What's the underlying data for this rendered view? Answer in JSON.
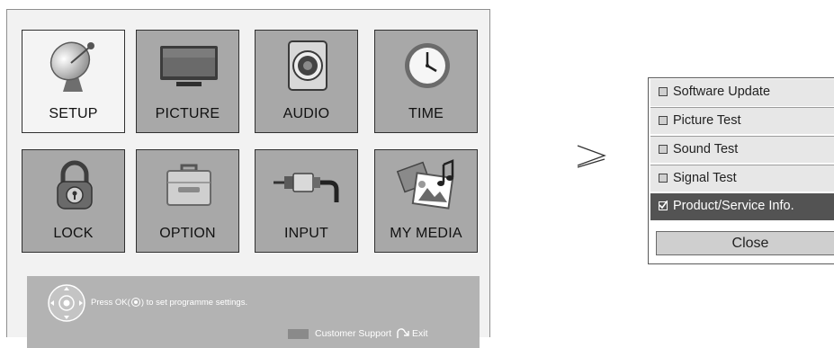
{
  "menu": {
    "tiles": [
      {
        "label": "SETUP",
        "icon": "satellite-dish-icon",
        "selected": true
      },
      {
        "label": "PICTURE",
        "icon": "tv-monitor-icon",
        "selected": false
      },
      {
        "label": "AUDIO",
        "icon": "speaker-icon",
        "selected": false
      },
      {
        "label": "TIME",
        "icon": "clock-icon",
        "selected": false
      },
      {
        "label": "LOCK",
        "icon": "padlock-icon",
        "selected": false
      },
      {
        "label": "OPTION",
        "icon": "toolbox-icon",
        "selected": false
      },
      {
        "label": "INPUT",
        "icon": "cable-plug-icon",
        "selected": false
      },
      {
        "label": "MY MEDIA",
        "icon": "media-files-icon",
        "selected": false
      }
    ]
  },
  "help_bar": {
    "prefix": "Press OK(",
    "suffix": ") to set programme settings.",
    "customer_support": "Customer Support",
    "exit": "Exit"
  },
  "arrow": "≥",
  "submenu": {
    "items": [
      {
        "label": "Software Update",
        "checked": false,
        "highlighted": false
      },
      {
        "label": "Picture Test",
        "checked": false,
        "highlighted": false
      },
      {
        "label": "Sound Test",
        "checked": false,
        "highlighted": false
      },
      {
        "label": "Signal Test",
        "checked": false,
        "highlighted": false
      },
      {
        "label": "Product/Service Info.",
        "checked": true,
        "highlighted": true
      }
    ],
    "close_label": "Close"
  },
  "colors": {
    "tile_bg": "#a8a8a8",
    "tile_selected_bg": "#f4f4f4",
    "help_bar_bg": "#b3b3b3",
    "submenu_item_bg": "#e7e7e7",
    "submenu_highlight_bg": "#535353"
  }
}
